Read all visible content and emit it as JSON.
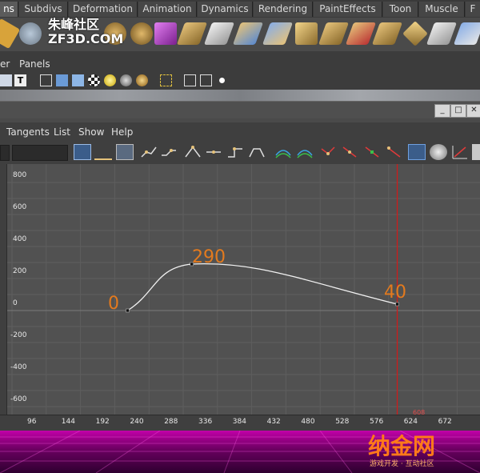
{
  "shelf": {
    "tabs": [
      "ns",
      "Subdivs",
      "Deformation",
      "Animation",
      "Dynamics",
      "Rendering",
      "PaintEffects",
      "Toon",
      "Muscle",
      "F"
    ],
    "active_tab": "ns"
  },
  "watermark": {
    "line1": "朱峰社区",
    "line2": "ZF3D.COM"
  },
  "panels_menu": {
    "items": [
      "er",
      "Panels"
    ]
  },
  "graph_editor": {
    "menu": [
      "Tangents",
      "List",
      "Show",
      "Help"
    ],
    "y_ticks": [
      "800",
      "600",
      "400",
      "200",
      "0",
      "-200",
      "-400",
      "-600"
    ],
    "x_ticks": [
      "96",
      "144",
      "192",
      "240",
      "288",
      "336",
      "384",
      "432",
      "480",
      "528",
      "576",
      "624",
      "672"
    ],
    "current_frame": "608",
    "curve_color": "#f2f2f2",
    "time_marker_color": "#d21a1a",
    "grid_color": "#5e5e5e",
    "background_color": "#515151",
    "annotations": [
      "0",
      "290",
      "40"
    ],
    "annotation_color": "#e37a1e"
  },
  "chart_data": {
    "type": "line",
    "series": [
      {
        "x": [
          230,
          320,
          608
        ],
        "y": [
          0,
          290,
          40
        ]
      }
    ],
    "xlim": [
      80,
      700
    ],
    "ylim": [
      -650,
      850
    ]
  },
  "banner": {
    "logo": "纳金网",
    "subtitle": "游戏开发 · 互动社区"
  }
}
